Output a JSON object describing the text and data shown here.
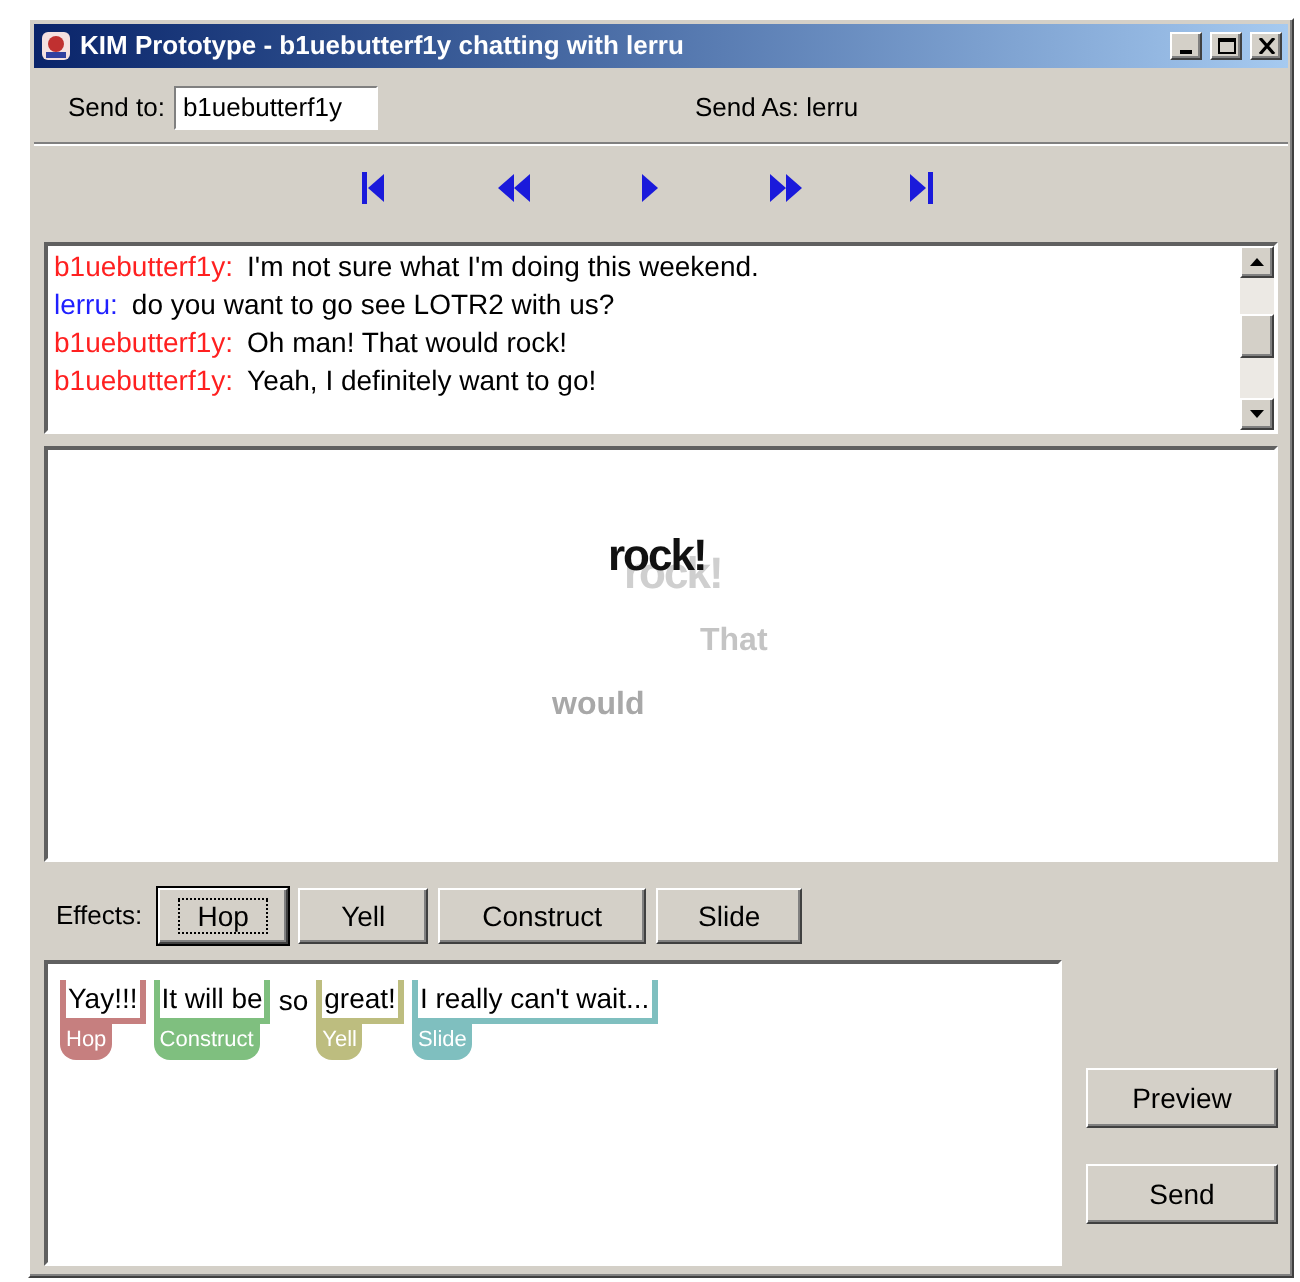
{
  "window": {
    "title": "KIM Prototype - b1uebutterf1y chatting with lerru"
  },
  "send_to": {
    "label": "Send to:",
    "value": "b1uebutterf1y"
  },
  "send_as": "Send As: lerru",
  "transport": [
    {
      "kind": "first"
    },
    {
      "kind": "rewind"
    },
    {
      "kind": "play"
    },
    {
      "kind": "forward"
    },
    {
      "kind": "last"
    }
  ],
  "chat": [
    {
      "sender": "b1uebutterf1y:",
      "text": "I'm not sure what I'm doing this weekend.",
      "color": "#ff2020"
    },
    {
      "sender": "lerru:",
      "text": "do you want to go see LOTR2 with us?",
      "color": "#2020ff"
    },
    {
      "sender": "b1uebutterf1y:",
      "text": "Oh man!  That would rock!",
      "color": "#ff2020"
    },
    {
      "sender": "b1uebutterf1y:",
      "text": "Yeah, I definitely want to go!",
      "color": "#ff2020"
    }
  ],
  "preview": [
    {
      "text": "rock!",
      "kind": "main"
    },
    {
      "text": "That",
      "kind": "faint"
    },
    {
      "text": "would",
      "kind": "mid"
    }
  ],
  "effects": {
    "label": "Effects:",
    "buttons": [
      {
        "label": "Hop",
        "selected": true
      },
      {
        "label": "Yell",
        "selected": false
      },
      {
        "label": "Construct",
        "selected": false
      },
      {
        "label": "Slide",
        "selected": false
      }
    ]
  },
  "message": [
    {
      "text": "Yay!!!",
      "effect": "Hop",
      "color": "#c67f7f"
    },
    {
      "text": "It will be",
      "effect": "Construct",
      "color": "#7fbf7f"
    },
    {
      "text": "so"
    },
    {
      "text": "great!",
      "effect": "Yell",
      "color": "#bdbd7f"
    },
    {
      "text": "I really can't wait...",
      "effect": "Slide",
      "color": "#7fbfbf"
    }
  ],
  "actions": [
    "Preview",
    "Send"
  ]
}
